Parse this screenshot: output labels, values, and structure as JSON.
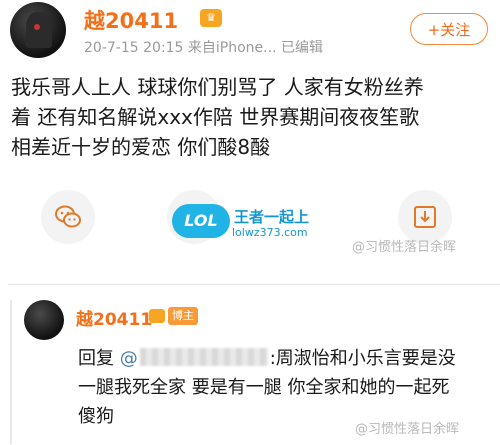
{
  "post": {
    "author": "越20411",
    "vip_icon": "vip-crown-icon",
    "time": "20-7-15 20:15",
    "source": "来自iPhone...",
    "edited": "已编辑",
    "follow_label": "+关注",
    "lines": [
      "我乐哥人上人 球球你们别骂了 人家有女粉丝养",
      "着 还有知名解说xxx作陪 世界赛期间夜夜笙歌",
      "相差近十岁的爱恋 你们酸8酸"
    ]
  },
  "share": {
    "icons": [
      "wechat-icon",
      "moments-icon",
      "save-image-icon"
    ]
  },
  "watermarks": {
    "logo": "LOL",
    "site_cn": "王者一起上",
    "site_url": "lolwz373.com",
    "weibo": "@习惯性落日余晖"
  },
  "reply": {
    "author": "越20411",
    "badge": "博主",
    "prefix": "回复",
    "at": "@",
    "text_after_mention": ":周淑怡和小乐言要是没",
    "line2": "一腿我死全家 要是有一腿 你全家和她的一起死",
    "line3": "傻狗"
  },
  "colors": {
    "accent": "#f46f1a",
    "follow_border": "#f48a3e",
    "muted": "#9a9a9a"
  }
}
